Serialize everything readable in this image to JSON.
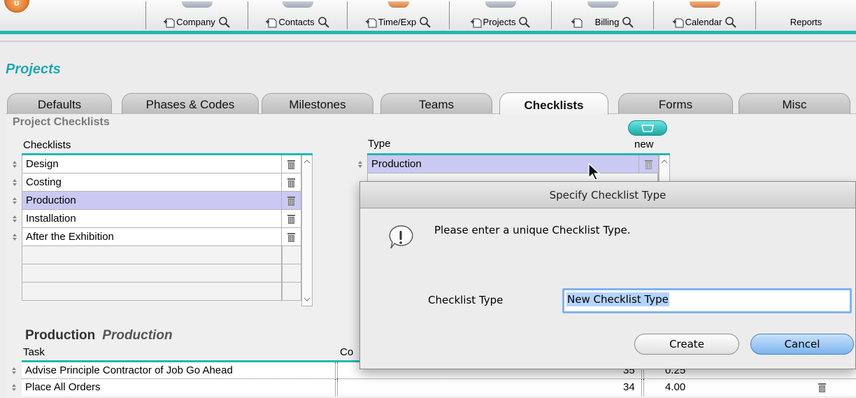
{
  "toolbar": {
    "buttons": [
      {
        "label": "Company",
        "icon": "new-record-icon",
        "search_icon": "magnifier-icon"
      },
      {
        "label": "Contacts",
        "icon": "new-record-icon",
        "search_icon": "magnifier-icon"
      },
      {
        "label": "Time/Exp",
        "icon": "new-record-icon",
        "search_icon": "magnifier-icon"
      },
      {
        "label": "Projects",
        "icon": "new-record-icon",
        "search_icon": "magnifier-icon"
      },
      {
        "label": "Billing",
        "icon": "new-record-icon",
        "search_icon": "magnifier-icon"
      },
      {
        "label": "Calendar",
        "icon": "new-record-icon",
        "search_icon": "magnifier-icon"
      },
      {
        "label": "Reports"
      }
    ],
    "accent": "#25b6b2"
  },
  "page_title": "Projects",
  "tabs": [
    {
      "label": "Defaults"
    },
    {
      "label": "Phases & Codes"
    },
    {
      "label": "Milestones"
    },
    {
      "label": "Teams"
    },
    {
      "label": "Checklists",
      "active": true
    },
    {
      "label": "Forms"
    },
    {
      "label": "Misc"
    }
  ],
  "section_title": "Project Checklists",
  "checklists": {
    "header": "Checklists",
    "items": [
      "Design",
      "Costing",
      "Production",
      "Installation",
      "After the Exhibition"
    ],
    "selected": "Production"
  },
  "types": {
    "header": "Type",
    "items": [
      "Production"
    ],
    "new_label": "new"
  },
  "production": {
    "title": "Production",
    "subtitle": "Production",
    "task_header": "Task",
    "partial_header": "Co",
    "tasks": [
      {
        "task": "Advise Principle Contractor of Job Go Ahead",
        "num": "35",
        "value": "0.25"
      },
      {
        "task": "Place All Orders",
        "num": "34",
        "value": "4.00"
      }
    ]
  },
  "dialog": {
    "title": "Specify Checklist Type",
    "message": "Please enter a unique Checklist Type.",
    "field_label": "Checklist Type",
    "field_value": "New Checklist Type",
    "create_label": "Create",
    "cancel_label": "Cancel",
    "icon": "exclamation-icon"
  },
  "colors": {
    "selected_row": "#c9c9f3",
    "title_teal": "#21a7b4",
    "default_button": "#7cb4ee"
  }
}
